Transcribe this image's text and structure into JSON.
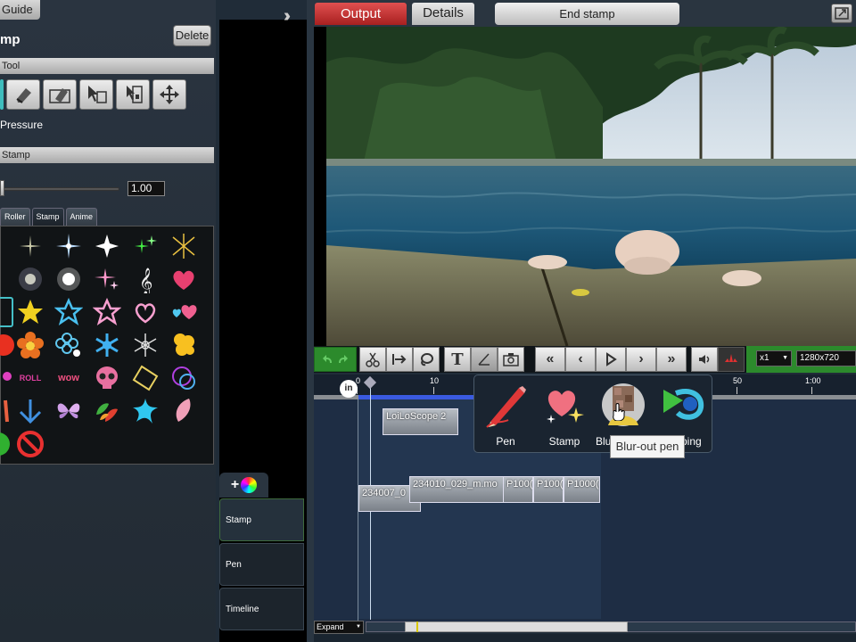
{
  "guide_tab": "Guide",
  "left_panel": {
    "title": "mp",
    "delete_label": "Delete",
    "tool_section": "Tool",
    "pressure_label": "Pressure",
    "stamp_section": "Stamp",
    "slider": {
      "value_text": "1.00",
      "value": 0.0
    },
    "stamp_tabs": [
      "Roller",
      "Stamp",
      "Anime"
    ],
    "selected_stamp_tab": "Stamp",
    "stamp_texts": {
      "roll": "ROLL",
      "wow": "wow"
    }
  },
  "side_tabs": [
    "Stamp",
    "Pen",
    "Timeline"
  ],
  "top_bar": {
    "output_tab": "Output",
    "details_tab": "Details",
    "end_stamp": "End stamp"
  },
  "toolbar": {
    "speed": "x1",
    "resolution": "1280x720"
  },
  "timeline": {
    "in_marker": "in",
    "ruler_labels": [
      "0",
      "10",
      "50",
      "1:00"
    ],
    "clips": [
      "LoiLoScope 2",
      "234007_0",
      "234010_029_m.mo",
      "P100(",
      "P100(",
      "P1000("
    ],
    "expand": "Expand"
  },
  "popup": {
    "items": [
      "Pen",
      "Stamp",
      "Blur-out pen",
      "Clipping"
    ],
    "tooltip": "Blur-out pen"
  },
  "colors": {
    "output_tab": "#c03030",
    "accent_green": "#2c8a2c",
    "timeline_blue": "#3a5ae0"
  }
}
